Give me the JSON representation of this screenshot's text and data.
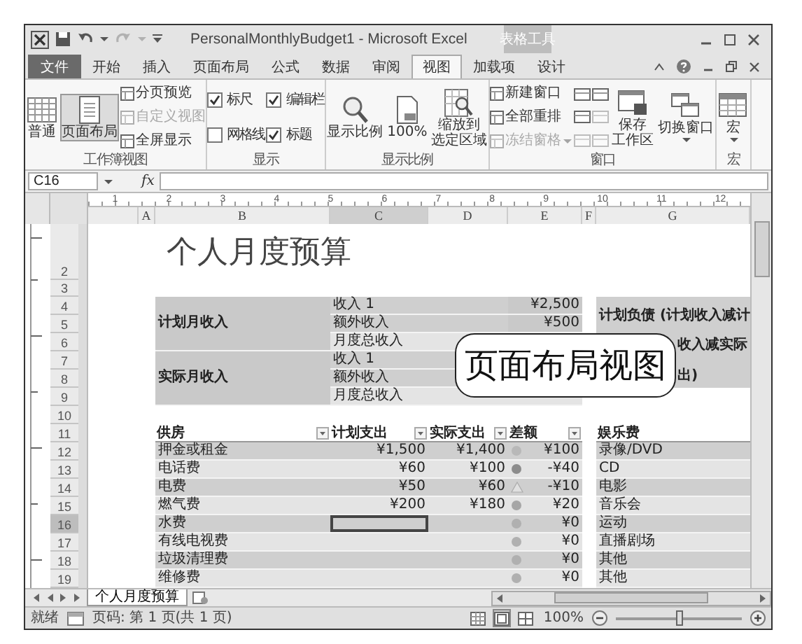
{
  "window": {
    "title": "PersonalMonthlyBudget1 - Microsoft Excel",
    "context_label": "表格工具"
  },
  "quick_access": [
    {
      "disabled": false
    },
    {
      "disabled": false
    },
    {
      "disabled": true
    }
  ],
  "tabs": [
    {
      "label": "文件",
      "kind": "file",
      "selected": false
    },
    {
      "label": "开始",
      "kind": "tab",
      "selected": false
    },
    {
      "label": "插入",
      "kind": "tab",
      "selected": false
    },
    {
      "label": "页面布局",
      "kind": "tab",
      "selected": false
    },
    {
      "label": "公式",
      "kind": "tab",
      "selected": false
    },
    {
      "label": "数据",
      "kind": "tab",
      "selected": false
    },
    {
      "label": "审阅",
      "kind": "tab",
      "selected": false
    },
    {
      "label": "视图",
      "kind": "tab",
      "selected": true
    },
    {
      "label": "加载项",
      "kind": "tab",
      "selected": false
    },
    {
      "label": "设计",
      "kind": "context",
      "selected": false
    }
  ],
  "ribbon": [
    {
      "label": "工作簿视图",
      "columns": [
        [
          {
            "kind": "large",
            "label": "普通",
            "selected": false
          }
        ],
        [
          {
            "kind": "large",
            "label": "页面布局",
            "selected": true
          }
        ],
        [
          {
            "kind": "small",
            "label": "分页预览",
            "disabled": false
          },
          {
            "kind": "small",
            "label": "自定义视图",
            "disabled": true
          },
          {
            "kind": "small",
            "label": "全屏显示",
            "disabled": false
          }
        ]
      ]
    },
    {
      "label": "显示",
      "columns": [
        [
          {
            "kind": "check",
            "label": "标尺",
            "checked": true
          },
          {
            "kind": "check",
            "label": "网格线",
            "checked": false
          }
        ],
        [
          {
            "kind": "check",
            "label": "编辑栏",
            "checked": true
          },
          {
            "kind": "check",
            "label": "标题",
            "checked": true
          }
        ]
      ]
    },
    {
      "label": "显示比例",
      "columns": [
        [
          {
            "kind": "large",
            "label": "显示比例",
            "selected": false
          }
        ],
        [
          {
            "kind": "large",
            "label": "100%",
            "selected": false
          }
        ],
        [
          {
            "kind": "large",
            "lines": [
              "缩放到",
              "选定区域"
            ],
            "selected": false
          }
        ]
      ]
    },
    {
      "label": "窗口",
      "columns": [
        [
          {
            "kind": "small",
            "label": "新建窗口",
            "disabled": false
          },
          {
            "kind": "small",
            "label": "全部重排",
            "disabled": false
          },
          {
            "kind": "small",
            "label": "冻结窗格",
            "disabled": true,
            "caret": true
          }
        ],
        [
          {
            "kind": "icon",
            "disabled": false
          },
          {
            "kind": "icon",
            "disabled": false
          },
          {
            "kind": "icon",
            "disabled": true
          }
        ],
        [
          {
            "kind": "icon",
            "disabled": false
          },
          {
            "kind": "icon",
            "disabled": true
          },
          {
            "kind": "icon",
            "disabled": true
          }
        ],
        [
          {
            "kind": "large",
            "lines": [
              "保存",
              "工作区"
            ],
            "selected": false
          }
        ],
        [
          {
            "kind": "large",
            "label": "切换窗口",
            "selected": false,
            "caret": true
          }
        ]
      ]
    },
    {
      "label": "宏",
      "columns": [
        [
          {
            "kind": "large",
            "label": "宏",
            "selected": false,
            "caret": true
          }
        ]
      ]
    }
  ],
  "formula_bar": {
    "name_box": "C16",
    "function_label": "fx"
  },
  "ruler": [
    "1",
    "2",
    "3",
    "4",
    "5",
    "6",
    "7",
    "8",
    "9",
    "10",
    "11",
    "12"
  ],
  "columns": [
    "A",
    "B",
    "C",
    "D",
    "E",
    "F",
    "G"
  ],
  "rows": [
    "2",
    "3",
    "4",
    "5",
    "6",
    "7",
    "8",
    "9",
    "10",
    "11",
    "12",
    "13",
    "14",
    "15",
    "16",
    "17",
    "18",
    "19"
  ],
  "title": "个人月度预算",
  "income": [
    {
      "label": "计划月收入",
      "items": [
        {
          "name": "收入 1",
          "kind": "item",
          "amount": "¥2,500"
        },
        {
          "name": "额外收入",
          "kind": "item",
          "amount": "¥500"
        },
        {
          "name": "月度总收入",
          "kind": "total"
        }
      ]
    },
    {
      "label": "实际月收入",
      "items": [
        {
          "name": "收入 1",
          "kind": "item"
        },
        {
          "name": "额外收入",
          "kind": "item"
        },
        {
          "name": "月度总收入",
          "kind": "total"
        }
      ]
    }
  ],
  "balance": [
    {
      "lines": [
        "计划负债 (计划收入减计"
      ]
    },
    {
      "lines": [
        "收入减实际",
        "出)"
      ]
    }
  ],
  "expenses": {
    "columns": [
      "供房",
      "计划支出",
      "实际支出",
      "差额"
    ],
    "rows": [
      {
        "item": "押金或租金",
        "planned": "¥1,500",
        "actual": "¥1,400",
        "kind": "circle",
        "color": "#b8b8b8",
        "difference": "¥100",
        "selected": false
      },
      {
        "item": "电话费",
        "planned": "¥60",
        "actual": "¥100",
        "kind": "circle",
        "color": "#8c8c8c",
        "difference": "-¥40",
        "selected": false
      },
      {
        "item": "电费",
        "planned": "¥50",
        "actual": "¥60",
        "kind": "triangle",
        "color": "#e0e0e0",
        "difference": "-¥10",
        "selected": false
      },
      {
        "item": "燃气费",
        "planned": "¥200",
        "actual": "¥180",
        "kind": "circle",
        "color": "#a6a6a6",
        "difference": "¥20",
        "selected": false
      },
      {
        "item": "水费",
        "kind": "circle",
        "color": "#b0b0b0",
        "difference": "¥0",
        "selected": true
      },
      {
        "item": "有线电视费",
        "kind": "circle",
        "color": "#b0b0b0",
        "difference": "¥0",
        "selected": false
      },
      {
        "item": "垃圾清理费",
        "kind": "circle",
        "color": "#b0b0b0",
        "difference": "¥0",
        "selected": false
      },
      {
        "item": "维修费",
        "kind": "circle",
        "color": "#b0b0b0",
        "difference": "¥0",
        "selected": false
      }
    ]
  },
  "entertainment": {
    "title": "娱乐费",
    "items": [
      "录像/DVD",
      "CD",
      "电影",
      "音乐会",
      "运动",
      "直播剧场",
      "其他",
      "其他"
    ]
  },
  "callout": "页面布局视图",
  "sheet_tabs": [
    {
      "label": "个人月度预算",
      "selected": true
    }
  ],
  "status_bar": {
    "mode": "就绪",
    "page": "页码: 第 1 页(共 1 页)",
    "views": [
      {
        "selected": false
      },
      {
        "selected": true
      },
      {
        "selected": false
      }
    ],
    "zoom": "100%",
    "zoom_slider": {
      "level": 0.5
    }
  }
}
